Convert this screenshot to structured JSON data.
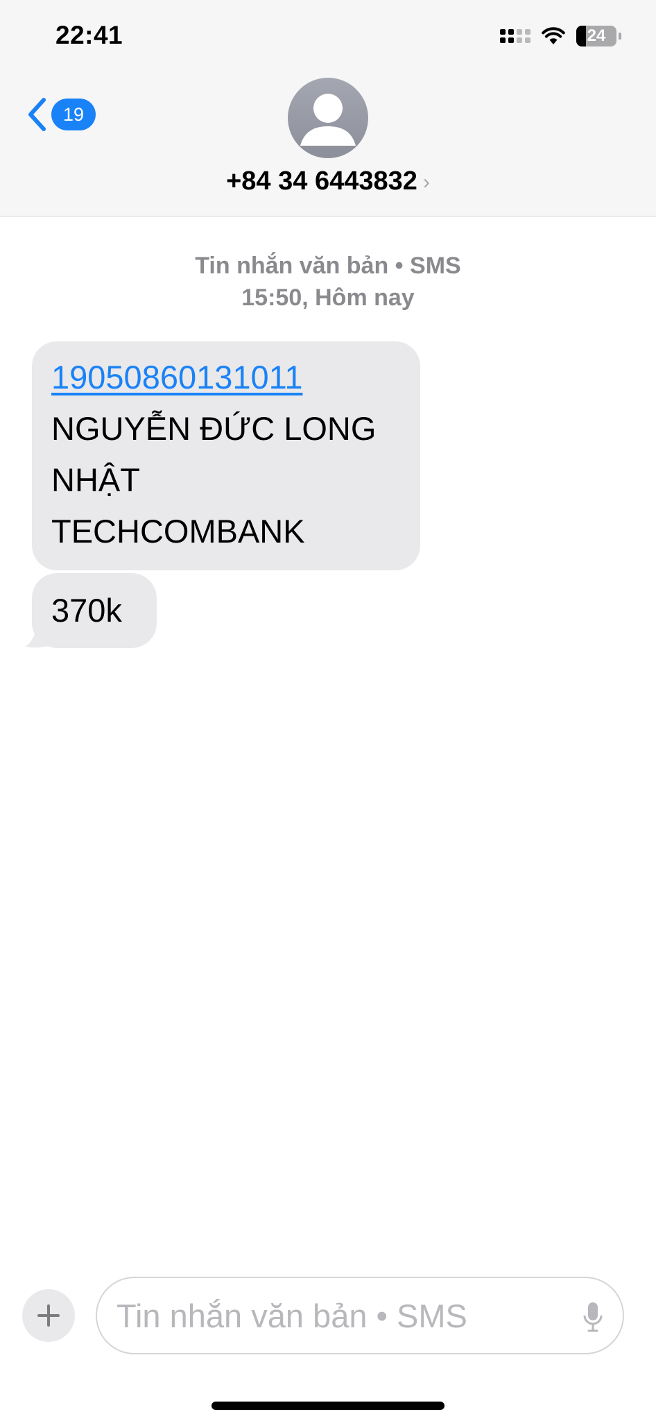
{
  "status_bar": {
    "time": "22:41",
    "battery_level": "24",
    "icons": [
      "cellular-signal-icon",
      "wifi-icon",
      "battery-icon"
    ]
  },
  "nav": {
    "back_icon": "chevron-left-icon",
    "unread_count": "19",
    "contact_name": "+84 34 6443832",
    "contact_chevron": "›",
    "avatar_icon": "person-icon"
  },
  "conversation": {
    "message_type": "Tin nhắn văn bản • SMS",
    "timestamp": "15:50, Hôm nay",
    "messages": [
      {
        "link": "19050860131011",
        "lines": [
          "NGUYỄN ĐỨC LONG",
          "NHẬT",
          "TECHCOMBANK"
        ]
      },
      {
        "text": "370k"
      }
    ]
  },
  "compose": {
    "plus_label": "+",
    "placeholder": "Tin nhắn văn bản • SMS",
    "value": "",
    "mic_icon": "microphone-icon"
  },
  "colors": {
    "accent": "#1a82f7",
    "bubble_gray": "#e9e9eb",
    "meta_gray": "#8a8a8e",
    "header_bg": "#f6f6f6"
  }
}
